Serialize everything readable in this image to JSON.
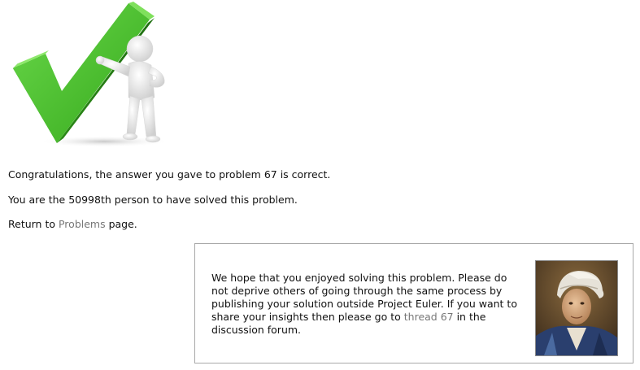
{
  "result": {
    "congrats_text": "Congratulations, the answer you gave to problem 67 is correct.",
    "solvers_text": "You are the 50998th person to have solved this problem.",
    "return_prefix": "Return to ",
    "problems_link": "Problems",
    "return_suffix": " page."
  },
  "info_box": {
    "text_before_link": "We hope that you enjoyed solving this problem. Please do not deprive others of going through the same process by publishing your solution outside Project Euler. If you want to share your insights then please go to ",
    "thread_link": "thread 67",
    "text_after_link": " in the discussion forum."
  },
  "icons": {
    "hero": "green-checkmark-with-figure",
    "portrait": "euler-portrait"
  },
  "colors": {
    "check_green": "#4cbf2e",
    "link_gray": "#777777",
    "box_border": "#a9a9a9"
  }
}
